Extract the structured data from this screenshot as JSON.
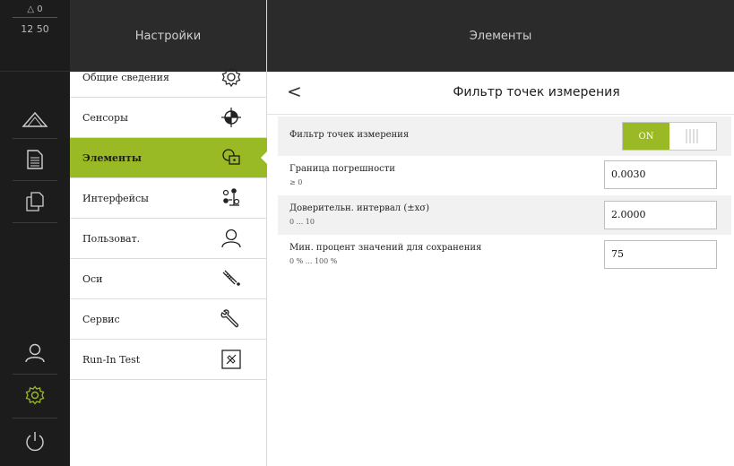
{
  "status": {
    "warnings": "△ 0",
    "clock": "12 50"
  },
  "sidebar": {
    "buttons": [
      {
        "icon": "measure-triangle-icon"
      },
      {
        "icon": "document-icon"
      },
      {
        "icon": "copy-documents-icon"
      },
      {
        "icon": "user-icon"
      },
      {
        "icon": "settings-gear-icon",
        "active": true
      },
      {
        "icon": "power-icon"
      }
    ],
    "accent_color": "#9aba25"
  },
  "menu": {
    "title": "Настройки",
    "items": [
      {
        "label": "Общие сведения",
        "icon": "gear-icon"
      },
      {
        "label": "Сенсоры",
        "icon": "sensor-target-icon"
      },
      {
        "label": "Элементы",
        "icon": "elements-icon",
        "active": true
      },
      {
        "label": "Интерфейсы",
        "icon": "interfaces-icon"
      },
      {
        "label": "Пользоват.",
        "icon": "user-icon"
      },
      {
        "label": "Оси",
        "icon": "axes-icon"
      },
      {
        "label": "Сервис",
        "icon": "wrench-icon"
      },
      {
        "label": "Run-In Test",
        "icon": "run-in-test-icon"
      }
    ]
  },
  "right": {
    "title": "Элементы",
    "back_label": "<",
    "sub_title": "Фильтр точек измерения",
    "rows": [
      {
        "label": "Фильтр точек измерения",
        "toggle": "ON"
      },
      {
        "label": "Граница погрешности",
        "range": "≥ 0",
        "value": "0.0030"
      },
      {
        "label": "Доверительн. интервал (±xσ)",
        "range": "0 ... 10",
        "value": "2.0000"
      },
      {
        "label": "Мин. процент значений для сохранения",
        "range": "0 % ... 100 %",
        "value": "75"
      }
    ]
  }
}
